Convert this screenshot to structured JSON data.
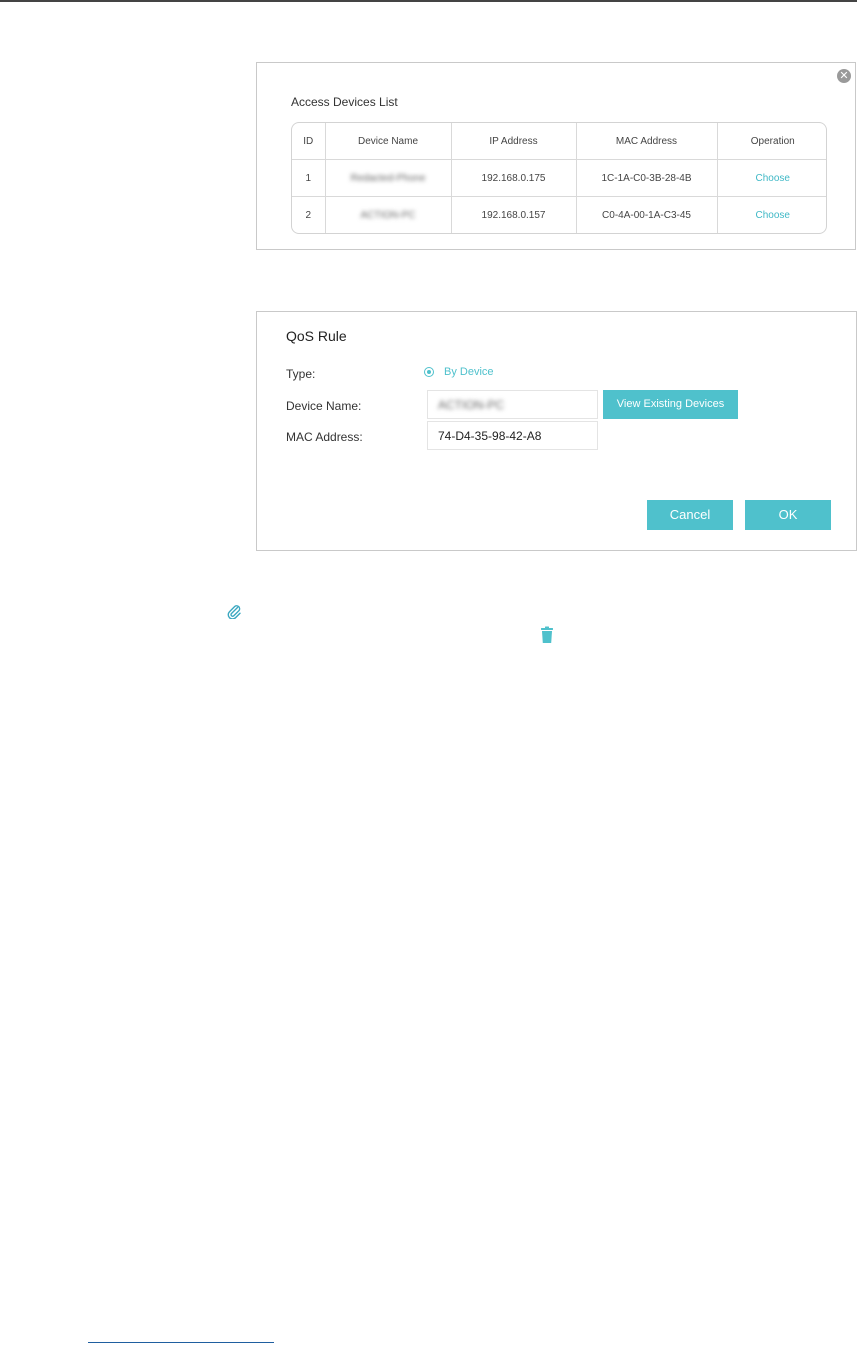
{
  "access_devices_list": {
    "title": "Access Devices List",
    "close_icon": "close-circle-icon",
    "columns": [
      "ID",
      "Device Name",
      "IP Address",
      "MAC Address",
      "Operation"
    ],
    "rows": [
      {
        "id": "1",
        "device_name": "Redacted-Phone",
        "ip": "192.168.0.175",
        "mac": "1C-1A-C0-3B-28-4B",
        "operation": "Choose"
      },
      {
        "id": "2",
        "device_name": "ACTION-PC",
        "ip": "192.168.0.157",
        "mac": "C0-4A-00-1A-C3-45",
        "operation": "Choose"
      }
    ]
  },
  "qos_rule": {
    "title": "QoS Rule",
    "type_label": "Type:",
    "type_option": "By Device",
    "device_name_label": "Device Name:",
    "device_name_value": "ACTION-PC",
    "view_devices_button": "View Existing Devices",
    "mac_label": "MAC Address:",
    "mac_value": "74-D4-35-98-42-A8",
    "cancel_button": "Cancel",
    "ok_button": "OK"
  },
  "icons": {
    "attachment": "paperclip-icon",
    "delete": "trash-icon"
  },
  "colors": {
    "accent": "#4fc1cc",
    "link": "#3fb8c6",
    "border": "#c9c9c9"
  }
}
